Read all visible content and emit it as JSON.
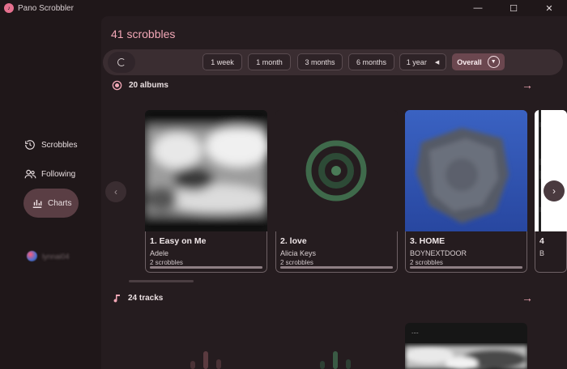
{
  "window": {
    "title": "Pano Scrobbler",
    "minimize": "—",
    "maximize": "☐",
    "close": "✕"
  },
  "sidebar": {
    "items": [
      {
        "label": "Scrobbles",
        "icon": "history-icon"
      },
      {
        "label": "Following",
        "icon": "people-icon"
      },
      {
        "label": "Charts",
        "icon": "chart-icon",
        "active": true
      }
    ],
    "user": {
      "name": "lynnai04"
    }
  },
  "header": {
    "scrobble_count": "41 scrobbles"
  },
  "periods": {
    "options": [
      "1 week",
      "1 month",
      "3 months",
      "6 months",
      "1 year"
    ],
    "selected": "Overall"
  },
  "albums": {
    "heading": "20 albums",
    "items": [
      {
        "rank_title": "1. Easy on Me",
        "artist": "Adele",
        "scrobbles": "2 scrobbles",
        "fill": 1.0
      },
      {
        "rank_title": "2. love",
        "artist": "Alicia Keys",
        "scrobbles": "2 scrobbles",
        "fill": 1.0
      },
      {
        "rank_title": "3. HOME",
        "artist": "BOYNEXTDOOR",
        "scrobbles": "2 scrobbles",
        "fill": 1.0
      },
      {
        "rank_title": "4",
        "artist": "B",
        "scrobbles": "",
        "fill": 1.0
      }
    ]
  },
  "tracks": {
    "heading": "24 tracks",
    "card_caption": "...."
  },
  "colors": {
    "accent": "#f2a7b6",
    "active_nav": "#5a3e44",
    "background": "#1f1719",
    "panel": "#251c1f"
  }
}
